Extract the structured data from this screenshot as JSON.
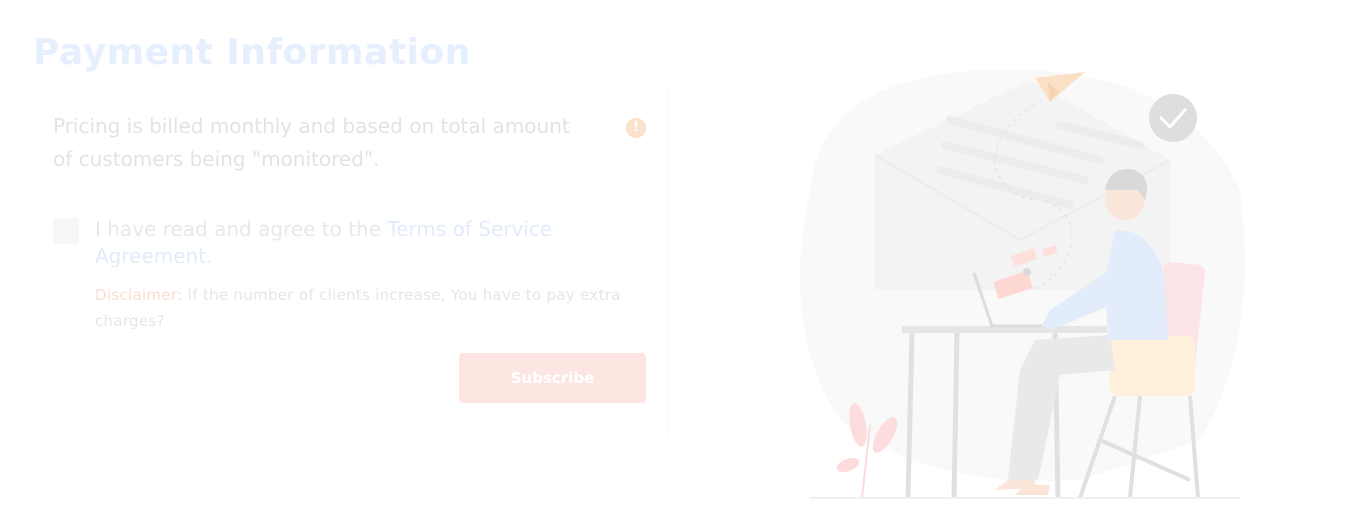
{
  "page": {
    "title": "Payment Information"
  },
  "pricing": {
    "text": "Pricing is billed monthly and based on total amount of customers being \"monitored\".",
    "info_icon": "info-icon",
    "info_glyph": "!"
  },
  "agreement": {
    "prefix": "I have read and agree to the ",
    "link_text": "Terms of Service Agreement.",
    "checked": false
  },
  "disclaimer": {
    "label": "Disclaimer:",
    "text": " If the number of clients increase, You have to pay extra charges?"
  },
  "actions": {
    "subscribe_label": "Subscribe"
  },
  "colors": {
    "accent_blue": "#e2ebfb",
    "accent_red": "#fde5e1",
    "accent_orange": "#fbe2cc"
  }
}
